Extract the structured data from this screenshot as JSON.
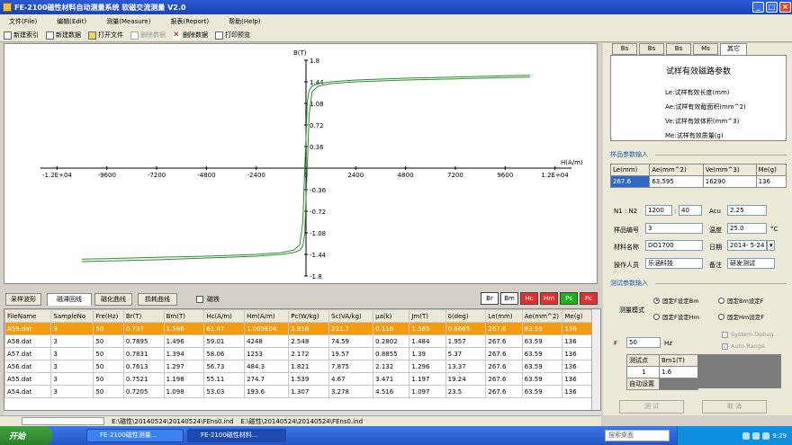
{
  "window": {
    "title": "FE-2100磁性材料自动测量系统  软磁交流测量  V2.0"
  },
  "menu": [
    "文件(File)",
    "编辑(Edit)",
    "测量(Measure)",
    "报表(Report)",
    "帮助(Help)"
  ],
  "toolbar": {
    "new_index": "新建索引",
    "new_data": "新建数据",
    "open_file": "打开文件",
    "delete_data": "删除数据",
    "delete_sel": "删除数据",
    "print_preview": "打印预览"
  },
  "chart": {
    "y_label": "B(T)",
    "x_label": "H(A/m)",
    "x_ticks": [
      "-1.2E+04",
      "-9600",
      "-7200",
      "-4800",
      "-2400",
      "0",
      "2400",
      "4800",
      "7200",
      "9600",
      "1.2E+04"
    ],
    "y_ticks": [
      "1.8",
      "1.44",
      "1.08",
      "0.72",
      "0.36",
      "0",
      "-0.36",
      "-0.72",
      "-1.08",
      "-1.44",
      "-1.8"
    ],
    "curve_color": "#2e8b2e",
    "axis_color": "#000000"
  },
  "chart_data": {
    "type": "line",
    "xlabel": "H(A/m)",
    "ylabel": "B(T)",
    "xlim": [
      -12800,
      12800
    ],
    "ylim": [
      -1.8,
      1.8
    ],
    "grid": false,
    "series": [
      {
        "values": [
          [
            -10800,
            -1.52
          ],
          [
            -9600,
            -1.51
          ],
          [
            -7200,
            -1.49
          ],
          [
            -4800,
            -1.47
          ],
          [
            -2400,
            -1.44
          ],
          [
            -1200,
            -1.41
          ],
          [
            -600,
            -1.37
          ],
          [
            -300,
            -1.28
          ],
          [
            -150,
            -0.9
          ],
          [
            -60,
            0.0
          ],
          [
            0,
            0.5
          ],
          [
            60,
            1.1
          ],
          [
            150,
            1.3
          ],
          [
            300,
            1.37
          ],
          [
            600,
            1.41
          ],
          [
            1200,
            1.44
          ],
          [
            2400,
            1.47
          ],
          [
            4800,
            1.5
          ],
          [
            7200,
            1.52
          ],
          [
            9600,
            1.54
          ],
          [
            10800,
            1.55
          ]
        ]
      },
      {
        "values": [
          [
            -10800,
            -1.56
          ],
          [
            -9600,
            -1.55
          ],
          [
            -7200,
            -1.53
          ],
          [
            -4800,
            -1.5
          ],
          [
            -2400,
            -1.47
          ],
          [
            -1200,
            -1.44
          ],
          [
            -600,
            -1.41
          ],
          [
            -300,
            -1.37
          ],
          [
            -150,
            -1.3
          ],
          [
            -60,
            -1.1
          ],
          [
            0,
            -0.5
          ],
          [
            60,
            0.0
          ],
          [
            150,
            0.9
          ],
          [
            300,
            1.28
          ],
          [
            600,
            1.37
          ],
          [
            1200,
            1.41
          ],
          [
            2400,
            1.44
          ],
          [
            4800,
            1.47
          ],
          [
            7200,
            1.49
          ],
          [
            9600,
            1.51
          ],
          [
            10800,
            1.52
          ]
        ]
      }
    ]
  },
  "tabs": [
    "采样波形",
    "磁滞回线",
    "磁化曲线",
    "损耗曲线"
  ],
  "checkbox_label": "磁铁",
  "legend_boxes": [
    {
      "label": "Br",
      "bg": "#ffffff",
      "color": "#000000"
    },
    {
      "label": "Bm",
      "bg": "#ffffff",
      "color": "#000000"
    },
    {
      "label": "Hc",
      "bg": "#e03030",
      "color": "#ffffff"
    },
    {
      "label": "Hm",
      "bg": "#e03030",
      "color": "#ffffff"
    },
    {
      "label": "Ps",
      "bg": "#1cb01c",
      "color": "#ffffff"
    },
    {
      "label": "Pc",
      "bg": "#e03030",
      "color": "#ffffff"
    }
  ],
  "table": {
    "headers": [
      "FileName",
      "SampleNo",
      "Fre(Hz)",
      "Br(T)",
      "Bm(T)",
      "Hc(A/m)",
      "Hm(A/m)",
      "Pc(W/kg)",
      "Sc(VA/kg)",
      "μa(k)",
      "Jm(T)",
      "δ(deg)",
      "Le(mm)",
      "Ae(mm^2)",
      "Me(g)"
    ],
    "rows": [
      [
        "A59.dat",
        "3",
        "50",
        "0.737",
        "1.586",
        "61.47",
        "1.005E04",
        "2.816",
        "231.7",
        "0.116",
        "1.565",
        "0.6665",
        "267.6",
        "63.59",
        "136"
      ],
      [
        "A58.dat",
        "3",
        "50",
        "0.7895",
        "1.496",
        "59.01",
        "4248",
        "2.548",
        "74.59",
        "0.2802",
        "1.484",
        "1.957",
        "267.6",
        "63.59",
        "136"
      ],
      [
        "A57.dat",
        "3",
        "50",
        "0.7831",
        "1.394",
        "58.06",
        "1253",
        "2.172",
        "19.57",
        "0.8855",
        "1.39",
        "5.37",
        "267.6",
        "63.59",
        "136"
      ],
      [
        "A56.dat",
        "3",
        "50",
        "0.7613",
        "1.297",
        "56.73",
        "484.3",
        "1.821",
        "7.875",
        "2.132",
        "1.296",
        "13.37",
        "267.6",
        "63.59",
        "136"
      ],
      [
        "A55.dat",
        "3",
        "50",
        "0.7521",
        "1.198",
        "55.11",
        "274.7",
        "1.539",
        "4.67",
        "3.471",
        "1.197",
        "19.24",
        "267.6",
        "63.59",
        "136"
      ],
      [
        "A54.dat",
        "3",
        "50",
        "0.7205",
        "1.098",
        "53.03",
        "193.6",
        "1.307",
        "3.278",
        "4.516",
        "1.097",
        "23.5",
        "267.6",
        "63.59",
        "136"
      ]
    ]
  },
  "status": [
    "E:\\磁性\\20140524\\20140524\\FEns0.ind",
    "E:\\磁性\\20140524\\20140524\\FEns0.ind"
  ],
  "side": {
    "tabs": [
      "Bs",
      "Bs",
      "Bs",
      "Ms",
      "其它"
    ],
    "info_heading": "试样有效磁路参数",
    "info_lines": [
      "Le:试样有效长度(mm)",
      "Ae:试样有效截面积(mm^2)",
      "Ve:试样有效体积(mm^3)",
      "Me:试样有效质量(g)"
    ],
    "sample_group": "样品参数输入",
    "sample_headers": [
      "Le(mm)",
      "Ae(mm^2)",
      "Ve(mm^3)",
      "Me(g)"
    ],
    "sample_values": [
      "267.6",
      "63.595",
      "16290",
      "136"
    ],
    "n_label": "N1 : N2",
    "n1": "1200",
    "n2": "40",
    "acu_label": "Acu",
    "acu": "2.25",
    "sample_no_label": "样品编号",
    "sample_no": "3",
    "temp_label": "温度",
    "temp": "25.0",
    "temp_unit": "°C",
    "material_label": "材料名称",
    "material": "DO1700",
    "date_label": "日期",
    "date": "2014- 5-24",
    "operator_label": "操作人员",
    "operator": "乐涵科技",
    "remark_label": "备注",
    "remark": "研发测试",
    "test_group": "测试参数输入",
    "mode_label": "测量模式",
    "radios": [
      "固定F设定Bm",
      "固定Bm设定F",
      "固定F设定Hm",
      "固定Hm设定F"
    ],
    "freq_label": "F",
    "freq": "50",
    "freq_unit": "Hz",
    "debug_label": "System Debug",
    "autorange_label": "Auto Range",
    "test_points_label": "测试点",
    "bm_label": "Bm1(T)",
    "row_no": "1",
    "bm_value": "1.6",
    "auto_set_label": "自动设置",
    "test_btn": "测  试",
    "cancel_btn": "取  消"
  },
  "taskbar": {
    "start": "开始",
    "tasks": [
      "FE-2100磁性测量...",
      "FE-2100磁性材料..."
    ],
    "search_placeholder": "搜索桌面",
    "clock": "9:29"
  }
}
